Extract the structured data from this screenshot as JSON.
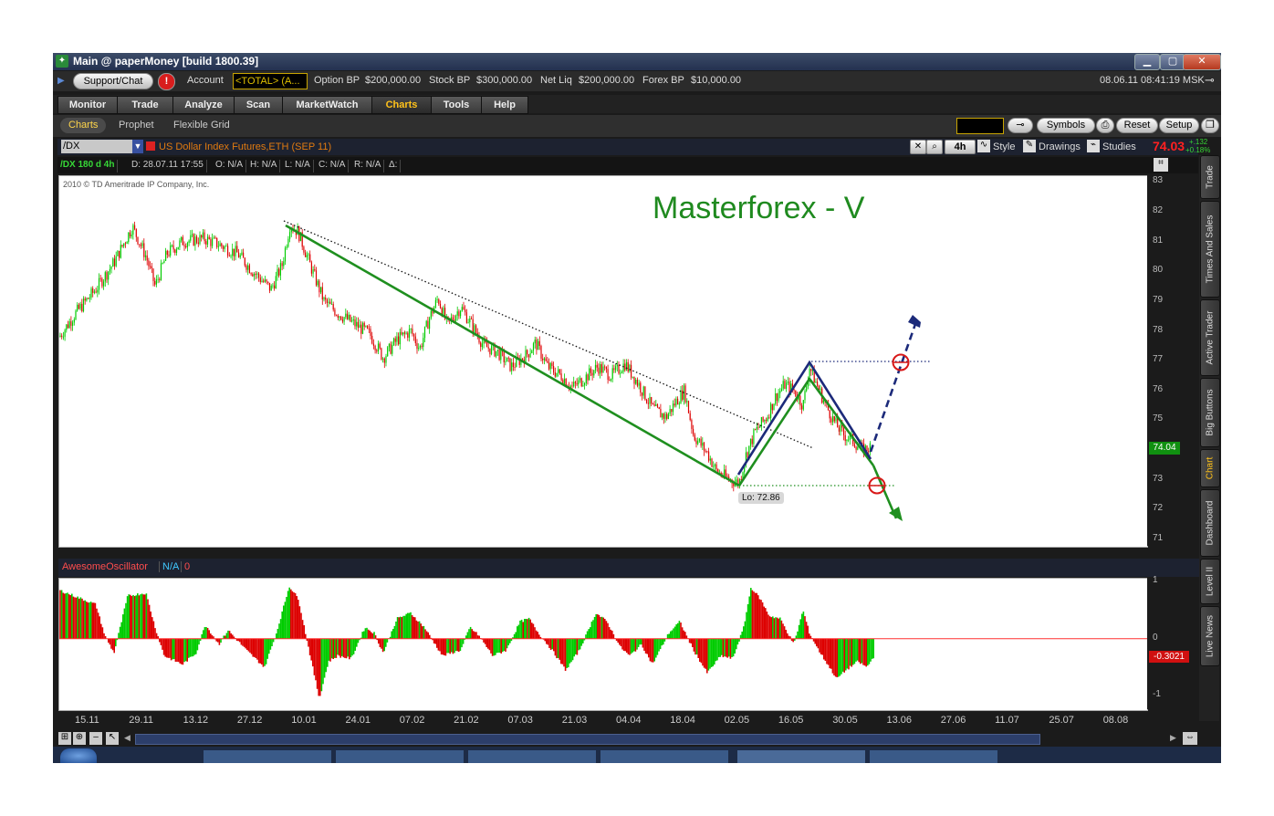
{
  "window": {
    "title": "Main @ paperMoney [build 1800.39]",
    "minimize": "▁",
    "maximize": "▢",
    "close": "✕"
  },
  "account_bar": {
    "support_label": "Support/Chat",
    "alert_label": "!",
    "account_label": "Account",
    "account_value": "<TOTAL> (A...",
    "option_bp_label": "Option BP",
    "option_bp": "$200,000.00",
    "stock_bp_label": "Stock BP",
    "stock_bp": "$300,000.00",
    "net_liq_label": "Net Liq",
    "net_liq": "$200,000.00",
    "forex_bp_label": "Forex BP",
    "forex_bp": "$10,000.00",
    "datetime": "08.06.11 08:41:19 MSK"
  },
  "nav_tabs": [
    {
      "label": "Monitor"
    },
    {
      "label": "Trade"
    },
    {
      "label": "Analyze"
    },
    {
      "label": "Scan"
    },
    {
      "label": "MarketWatch"
    },
    {
      "label": "Charts"
    },
    {
      "label": "Tools"
    },
    {
      "label": "Help"
    }
  ],
  "sub_tabs": [
    {
      "label": "Charts"
    },
    {
      "label": "Prophet"
    },
    {
      "label": "Flexible Grid"
    }
  ],
  "toolbar": {
    "symbols": "Symbols",
    "reset": "Reset",
    "setup": "Setup"
  },
  "chart_header": {
    "symbol": "/DX",
    "description": "US Dollar Index Futures,ETH (SEP 11)",
    "timeframe": "4h",
    "style": "Style",
    "drawings": "Drawings",
    "studies": "Studies",
    "last_price": "74.03",
    "change": "+.132",
    "change_pct": "+0.18%"
  },
  "info_row": {
    "name": "/DX 180 d 4h",
    "date": "D: 28.07.11 17:55",
    "open": "O: N/A",
    "high": "H: N/A",
    "low": "L: N/A",
    "close": "C: N/A",
    "range": "R: N/A",
    "extra": "Δ:"
  },
  "chart_text": {
    "copyright": "2010 © TD Ameritrade IP Company, Inc.",
    "annotation": "Masterforex - V",
    "low_label": "Lo: 72.86",
    "current_price_tag": "74.04"
  },
  "oscillator": {
    "name": "AwesomeOscillator",
    "value": "N/A",
    "extra": "0",
    "current_tag": "-0.3021"
  },
  "right_tabs": [
    {
      "label": "Trade"
    },
    {
      "label": "Times And Sales"
    },
    {
      "label": "Active Trader"
    },
    {
      "label": "Big Buttons"
    },
    {
      "label": "Chart"
    },
    {
      "label": "Dashboard"
    },
    {
      "label": "Level II"
    },
    {
      "label": "Live News"
    }
  ],
  "colors": {
    "up": "#00cc00",
    "down": "#dd0000",
    "channel": "#1f8f1f",
    "wave": "#1c2a7a",
    "annotation": "#1f8a1f"
  },
  "chart_data": {
    "type": "candlestick",
    "price_axis": {
      "ticks": [
        83,
        82,
        81,
        80,
        79,
        78,
        77,
        76,
        75,
        74,
        73,
        72,
        71
      ],
      "range": [
        70.85,
        83.1
      ]
    },
    "date_axis": [
      "15.11",
      "29.11",
      "13.12",
      "27.12",
      "10.01",
      "24.01",
      "07.02",
      "21.02",
      "07.03",
      "21.03",
      "04.04",
      "18.04",
      "02.05",
      "16.05",
      "30.05",
      "13.06",
      "27.06",
      "11.07",
      "25.07",
      "08.08"
    ],
    "price_path": [
      [
        0,
        77.8
      ],
      [
        18,
        78.6
      ],
      [
        40,
        79.4
      ],
      [
        60,
        80.3
      ],
      [
        80,
        81.5
      ],
      [
        95,
        80.5
      ],
      [
        105,
        79.5
      ],
      [
        118,
        80.6
      ],
      [
        135,
        81.0
      ],
      [
        158,
        81.1
      ],
      [
        175,
        80.9
      ],
      [
        195,
        80.6
      ],
      [
        212,
        80.0
      ],
      [
        232,
        79.4
      ],
      [
        244,
        80.2
      ],
      [
        253,
        81.6
      ],
      [
        262,
        81.3
      ],
      [
        275,
        80.2
      ],
      [
        290,
        79.0
      ],
      [
        305,
        78.6
      ],
      [
        320,
        78.3
      ],
      [
        340,
        77.9
      ],
      [
        355,
        77.1
      ],
      [
        370,
        77.7
      ],
      [
        385,
        78.0
      ],
      [
        395,
        77.4
      ],
      [
        405,
        78.4
      ],
      [
        415,
        79.1
      ],
      [
        425,
        78.2
      ],
      [
        440,
        78.8
      ],
      [
        452,
        78.2
      ],
      [
        465,
        77.5
      ],
      [
        480,
        77.3
      ],
      [
        495,
        76.8
      ],
      [
        512,
        77.2
      ],
      [
        522,
        77.6
      ],
      [
        535,
        76.8
      ],
      [
        550,
        76.5
      ],
      [
        562,
        76.1
      ],
      [
        575,
        76.4
      ],
      [
        590,
        76.8
      ],
      [
        605,
        76.5
      ],
      [
        620,
        76.9
      ],
      [
        635,
        76.2
      ],
      [
        650,
        75.4
      ],
      [
        665,
        75.1
      ],
      [
        675,
        75.6
      ],
      [
        685,
        76.0
      ],
      [
        695,
        74.5
      ],
      [
        710,
        73.9
      ],
      [
        720,
        73.3
      ],
      [
        735,
        73.0
      ],
      [
        745,
        72.9
      ],
      [
        752,
        73.8
      ],
      [
        762,
        74.6
      ],
      [
        775,
        75.1
      ],
      [
        785,
        75.8
      ],
      [
        795,
        76.2
      ],
      [
        805,
        76.0
      ],
      [
        815,
        75.5
      ],
      [
        822,
        76.8
      ],
      [
        830,
        76.2
      ],
      [
        840,
        75.5
      ],
      [
        850,
        74.9
      ],
      [
        860,
        74.5
      ],
      [
        870,
        74.3
      ],
      [
        880,
        74.0
      ],
      [
        890,
        74.1
      ]
    ],
    "oscillator_ticks": [
      1,
      0,
      -1
    ],
    "ao_range": [
      -1.25,
      1.05
    ],
    "ao_values": [
      [
        0,
        0.85
      ],
      [
        40,
        0.6
      ],
      [
        50,
        0.05
      ],
      [
        60,
        -0.25
      ],
      [
        75,
        0.75
      ],
      [
        95,
        0.8
      ],
      [
        105,
        0.2
      ],
      [
        115,
        -0.3
      ],
      [
        135,
        -0.45
      ],
      [
        150,
        -0.25
      ],
      [
        160,
        0.25
      ],
      [
        175,
        -0.1
      ],
      [
        185,
        0.15
      ],
      [
        205,
        -0.2
      ],
      [
        225,
        -0.5
      ],
      [
        238,
        0.1
      ],
      [
        252,
        0.92
      ],
      [
        262,
        0.7
      ],
      [
        275,
        -0.3
      ],
      [
        285,
        -1.05
      ],
      [
        295,
        -0.4
      ],
      [
        305,
        -0.3
      ],
      [
        320,
        -0.35
      ],
      [
        335,
        0.2
      ],
      [
        345,
        0.1
      ],
      [
        355,
        -0.25
      ],
      [
        370,
        0.35
      ],
      [
        385,
        0.45
      ],
      [
        400,
        0.2
      ],
      [
        420,
        -0.3
      ],
      [
        440,
        -0.2
      ],
      [
        450,
        0.2
      ],
      [
        460,
        0.05
      ],
      [
        475,
        -0.3
      ],
      [
        490,
        -0.2
      ],
      [
        505,
        0.3
      ],
      [
        515,
        0.35
      ],
      [
        525,
        0.1
      ],
      [
        540,
        -0.2
      ],
      [
        555,
        -0.55
      ],
      [
        570,
        -0.2
      ],
      [
        588,
        0.45
      ],
      [
        600,
        0.3
      ],
      [
        615,
        -0.15
      ],
      [
        625,
        -0.3
      ],
      [
        638,
        -0.1
      ],
      [
        650,
        -0.45
      ],
      [
        668,
        0.1
      ],
      [
        680,
        0.3
      ],
      [
        695,
        -0.2
      ],
      [
        710,
        -0.6
      ],
      [
        725,
        -0.3
      ],
      [
        738,
        -0.35
      ],
      [
        750,
        0.2
      ],
      [
        758,
        0.9
      ],
      [
        768,
        0.7
      ],
      [
        778,
        0.4
      ],
      [
        790,
        0.35
      ],
      [
        805,
        -0.1
      ],
      [
        815,
        0.5
      ],
      [
        822,
        0.1
      ],
      [
        832,
        -0.2
      ],
      [
        842,
        -0.45
      ],
      [
        852,
        -0.7
      ],
      [
        862,
        -0.55
      ],
      [
        875,
        -0.4
      ],
      [
        885,
        -0.5
      ],
      [
        893,
        -0.3
      ]
    ]
  }
}
